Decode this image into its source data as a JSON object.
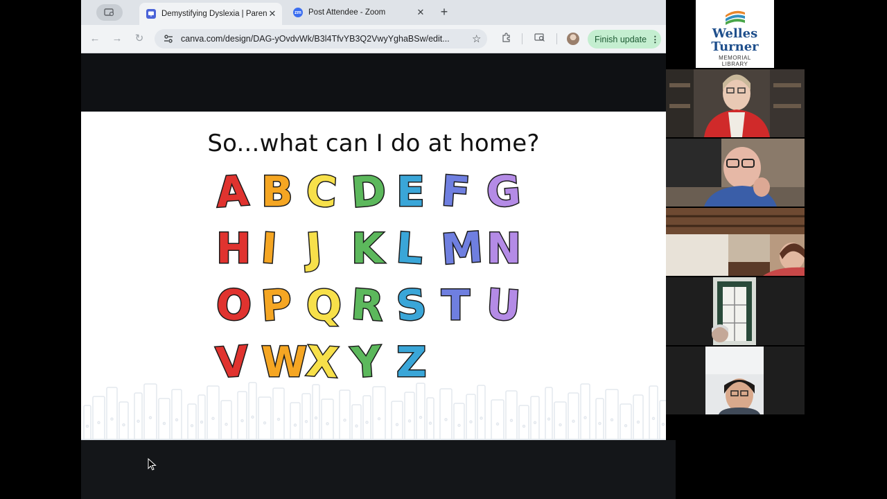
{
  "browser": {
    "tabs": [
      {
        "title": "Demystifying Dyslexia | Paren",
        "active": true,
        "favicon": "canva-presentation-icon"
      },
      {
        "title": "Post Attendee - Zoom",
        "active": false,
        "favicon": "zoom-icon",
        "favicon_text": "zm"
      }
    ],
    "url": "canva.com/design/DAG-yOvdvWk/B3l4TfvYB3Q2VwyYghaBSw/edit...",
    "finish_update_label": "Finish update"
  },
  "slide": {
    "title": "So...what can I do at home?",
    "letters": [
      {
        "char": "A",
        "color": "#e0332f"
      },
      {
        "char": "B",
        "color": "#f5a623"
      },
      {
        "char": "C",
        "color": "#f7e04a"
      },
      {
        "char": "D",
        "color": "#5cb85c"
      },
      {
        "char": "E",
        "color": "#3aa6d8"
      },
      {
        "char": "F",
        "color": "#6f7fe0"
      },
      {
        "char": "G",
        "color": "#b48be6"
      },
      {
        "char": "H",
        "color": "#e0332f"
      },
      {
        "char": "I",
        "color": "#f5a623"
      },
      {
        "char": "J",
        "color": "#f7e04a"
      },
      {
        "char": "K",
        "color": "#5cb85c"
      },
      {
        "char": "L",
        "color": "#3aa6d8"
      },
      {
        "char": "M",
        "color": "#6f7fe0"
      },
      {
        "char": "N",
        "color": "#b48be6"
      },
      {
        "char": "O",
        "color": "#e0332f"
      },
      {
        "char": "P",
        "color": "#f5a623"
      },
      {
        "char": "Q",
        "color": "#f7e04a"
      },
      {
        "char": "R",
        "color": "#5cb85c"
      },
      {
        "char": "S",
        "color": "#3aa6d8"
      },
      {
        "char": "T",
        "color": "#6f7fe0"
      },
      {
        "char": "U",
        "color": "#b48be6"
      },
      {
        "char": "V",
        "color": "#e0332f"
      },
      {
        "char": "W",
        "color": "#f5a623"
      },
      {
        "char": "X",
        "color": "#f7e04a"
      },
      {
        "char": "Y",
        "color": "#5cb85c"
      },
      {
        "char": "Z",
        "color": "#3aa6d8"
      }
    ]
  },
  "logo": {
    "line1": "Welles",
    "line2": "Turner",
    "line3": "MEMORIAL",
    "line4": "LIBRARY"
  },
  "participants": [
    "participant-1",
    "participant-2",
    "participant-3",
    "participant-4",
    "participant-5"
  ]
}
